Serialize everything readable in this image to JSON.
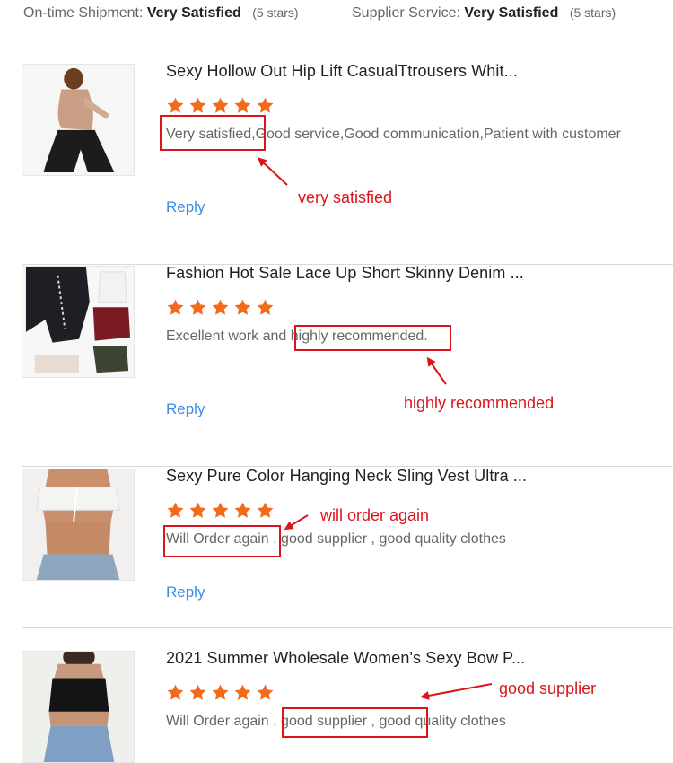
{
  "ratings": {
    "shipment": {
      "label": "On-time Shipment:",
      "value": "Very Satisfied",
      "stars": "(5 stars)"
    },
    "service": {
      "label": "Supplier Service:",
      "value": "Very Satisfied",
      "stars": "(5 stars)"
    }
  },
  "colors": {
    "star": "#f26a1b",
    "annotation": "#d9151c",
    "link": "#3a8ee6"
  },
  "reviews": [
    {
      "title": "Sexy Hollow Out Hip Lift CasualTtrousers Whit...",
      "rating": 5,
      "comment": "Very satisfied,Good service,Good communication,Patient with customer",
      "reply": "Reply",
      "annotation": "very satisfied"
    },
    {
      "title": "Fashion Hot Sale Lace Up Short Skinny Denim ...",
      "rating": 5,
      "comment": "Excellent work and highly recommended.",
      "reply": "Reply",
      "annotation": "highly recommended"
    },
    {
      "title": "Sexy Pure Color Hanging Neck Sling Vest Ultra ...",
      "rating": 5,
      "comment": "Will Order again , good supplier , good quality clothes",
      "reply": "Reply",
      "annotation": "will order again"
    },
    {
      "title": "2021 Summer Wholesale Women's Sexy Bow P...",
      "rating": 5,
      "comment": "Will Order again , good supplier , good quality clothes",
      "annotation": "good supplier"
    }
  ]
}
